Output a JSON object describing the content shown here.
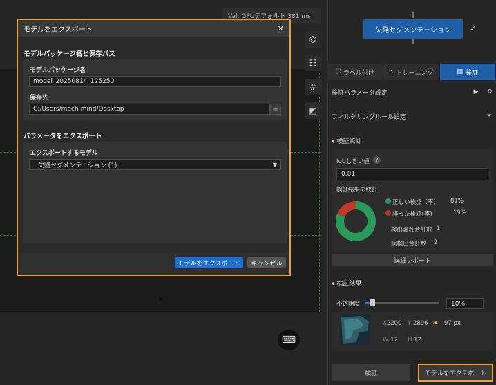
{
  "canvas": {
    "val_label": "Val:  GPUデフォルト  381 ms",
    "keyboard_icon": "keyboard-icon"
  },
  "top": {
    "segmentation_button": "欠陥セグメンテーション",
    "check_glyph": "✓"
  },
  "tabs": [
    {
      "label": "ラベル付け",
      "icon": "⛶"
    },
    {
      "label": "トレーニング",
      "icon": "⛬"
    },
    {
      "label": "検証",
      "icon": "▤"
    }
  ],
  "panel": {
    "validation_params": "検証パラメータ設定",
    "filter_rules": "フィルタリングルール設定",
    "stats_header": "検証統計",
    "iou_label": "IoUしきい値",
    "iou_value": "0.01",
    "results_stats": "検証結果の統計",
    "correct_label": "正しい検証（率）",
    "correct_value": "81%",
    "wrong_label": "誤った検証(率)",
    "wrong_value": "19%",
    "missed_label": "検出漏れ合計数",
    "missed_value": "1",
    "false_label": "誤検出合計数",
    "false_value": "2",
    "detail_report": "詳細レポート",
    "results_header": "検証結果",
    "opacity_label": "不透明度",
    "opacity_value": "10%",
    "x_label": "X",
    "x_value": "2200",
    "y_label": "Y",
    "y_value": "2896",
    "px_value": "97 px",
    "w_label": "W",
    "w_value": "12",
    "h_label": "H",
    "h_value": "12",
    "validate_button": "検証",
    "export_button": "モデルをエクスポート"
  },
  "colors": {
    "correct": "#2a9a5a",
    "wrong": "#c0392b",
    "accent": "#1f5fa8",
    "highlight": "#f0a030"
  },
  "dialog": {
    "title": "モデルをエクスポート",
    "close": "✕",
    "section1": "モデルパッケージ名と保存パス",
    "pkg_label": "モデルパッケージ名",
    "pkg_value": "model_20250814_125250",
    "save_label": "保存先",
    "save_value": "C:/Users/mech-mind/Desktop",
    "section2": "パラメータをエクスポート",
    "model_label": "エクスポートするモデル",
    "model_value": "欠陥セグメンテーション (1)",
    "export_button": "モデルをエクスポート",
    "cancel_button": "キャンセル"
  },
  "chart_data": {
    "type": "pie",
    "categories": [
      "正しい検証（率）",
      "誤った検証(率)"
    ],
    "values": [
      81,
      19
    ]
  }
}
